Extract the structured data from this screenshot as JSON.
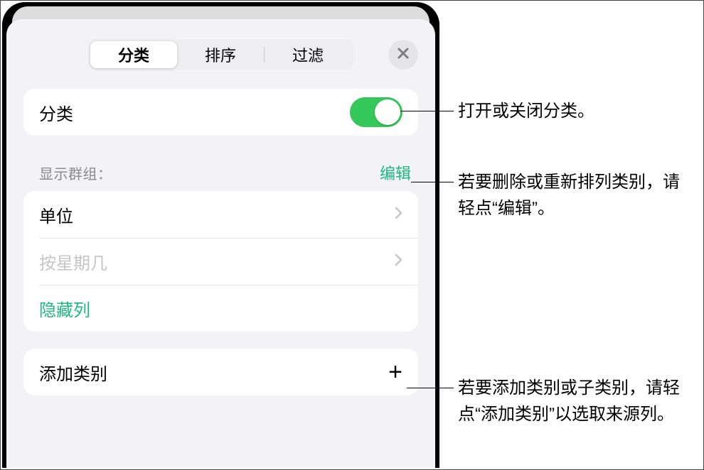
{
  "tabs": {
    "category": "分类",
    "sort": "排序",
    "filter": "过滤"
  },
  "toggleRow": {
    "label": "分类",
    "on": true
  },
  "groupsHeader": {
    "label": "显示群组：",
    "edit": "编辑"
  },
  "groups": {
    "item1": "单位",
    "item2": "按星期几",
    "hide": "隐藏列"
  },
  "addCategory": {
    "label": "添加类别"
  },
  "callouts": {
    "toggle": "打开或关闭分类。",
    "edit": "若要删除或重新排列类别，请轻点“编辑”。",
    "add": "若要添加类别或子类别，请轻点“添加类别”以选取来源列。"
  }
}
